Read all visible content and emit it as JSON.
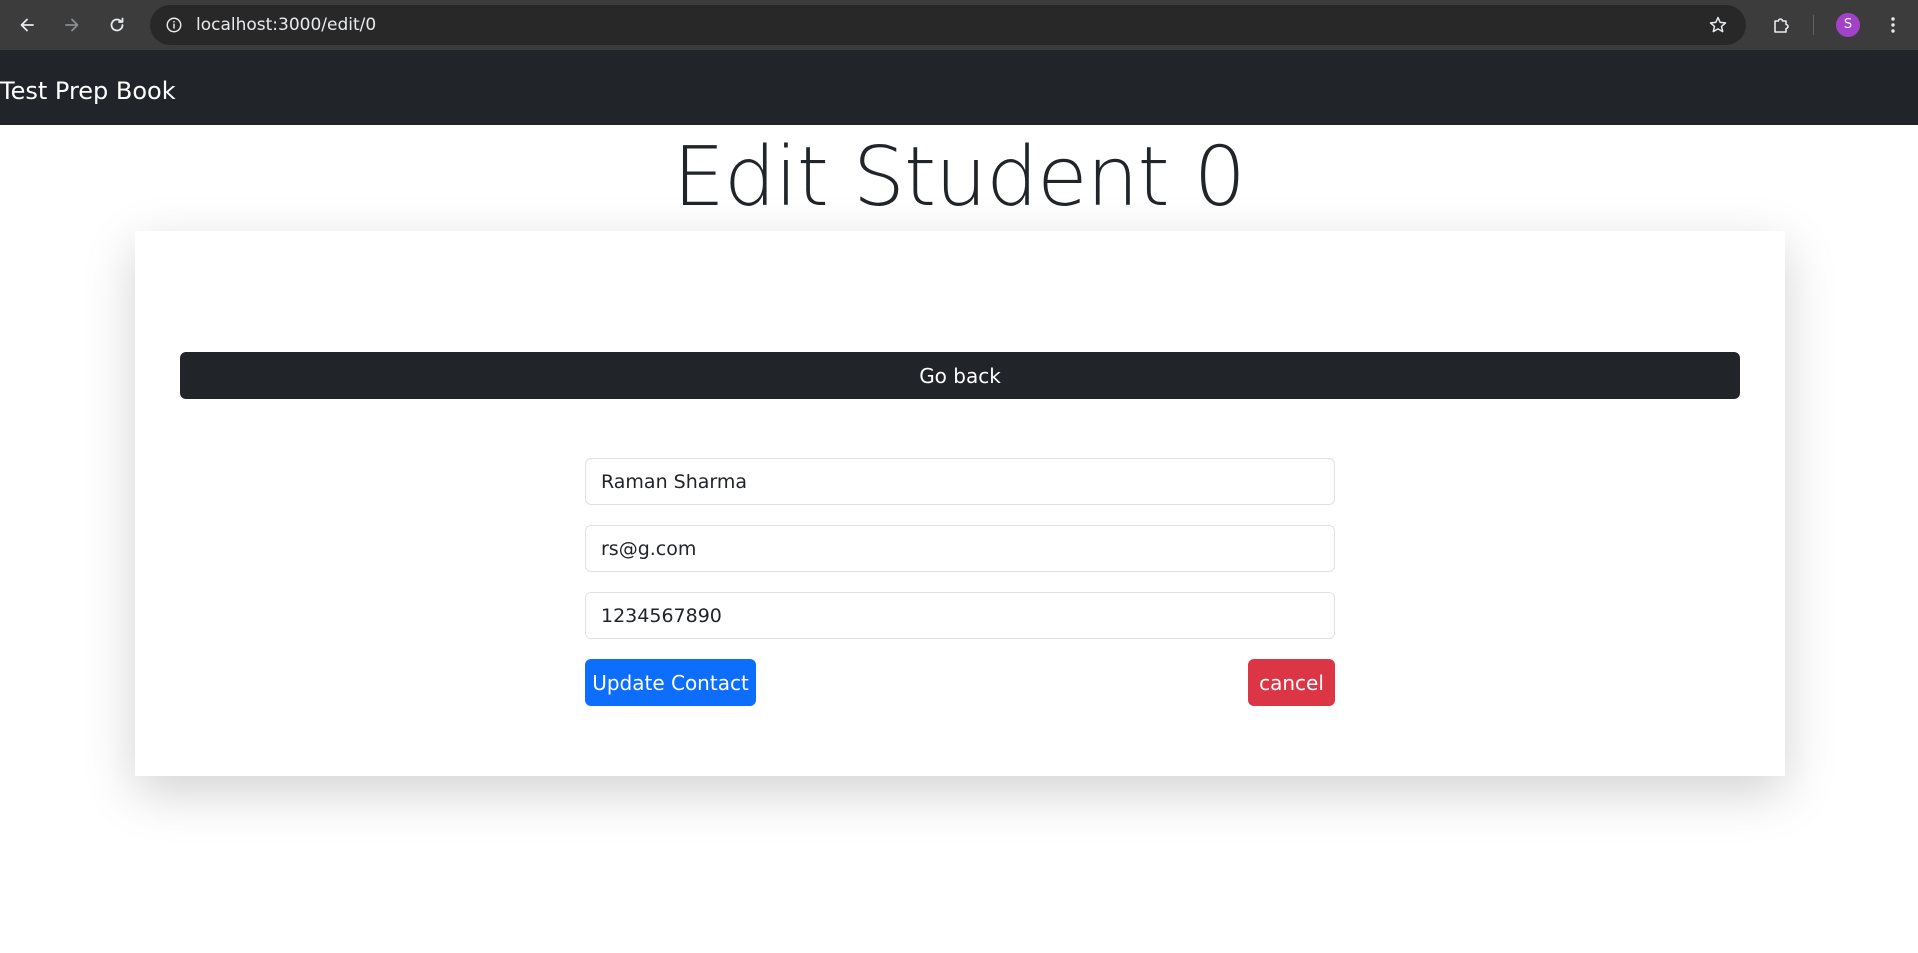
{
  "browser": {
    "url": "localhost:3000/edit/0",
    "profile_initial": "S",
    "icons": {
      "back": "arrow-left-icon",
      "forward": "arrow-right-icon",
      "reload": "reload-icon",
      "site_info": "info-icon",
      "bookmark": "star-icon",
      "extensions": "puzzle-icon",
      "menu": "kebab-menu-icon"
    },
    "colors": {
      "chrome_bg": "#3c3c3c",
      "omnibox_bg": "#282828",
      "avatar_bg": "#a142c9"
    }
  },
  "navbar": {
    "brand": "Test Prep Book",
    "bg_color": "#212529"
  },
  "page": {
    "title": "Edit Student 0"
  },
  "card": {
    "go_back_label": "Go back",
    "form": {
      "name_value": "Raman Sharma",
      "email_value": "rs@g.com",
      "phone_value": "1234567890",
      "update_label": "Update Contact",
      "cancel_label": "cancel"
    },
    "colors": {
      "go_back_bg": "#212529",
      "update_bg": "#0d6efd",
      "cancel_bg": "#dc3545"
    }
  }
}
